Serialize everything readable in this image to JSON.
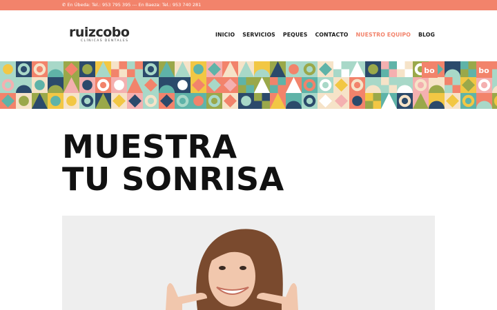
{
  "topbar": {
    "contact": "En Úbeda: Tel.: 953 795 395 --- En Baeza: Tel.: 953 740 281",
    "phone_icon": "phone-icon"
  },
  "logo": {
    "word": "ruizcobo",
    "tagline": "CLÍNICAS DENTALES"
  },
  "nav": {
    "items": [
      {
        "label": "INICIO"
      },
      {
        "label": "SERVICIOS"
      },
      {
        "label": "PEQUES"
      },
      {
        "label": "CONTACTO"
      },
      {
        "label": "NUESTRO EQUIPO"
      },
      {
        "label": "BLOG"
      }
    ]
  },
  "hero": {
    "line1": "MUESTRA",
    "line2": "TU SONRISA"
  },
  "pattern": {
    "badge_text": "bo"
  },
  "colors": {
    "accent": "#f2836b",
    "navy": "#2b4a6b",
    "teal": "#5fb3a8",
    "mint": "#a8d8c8",
    "yellow": "#f2c744",
    "olive": "#9aa84a",
    "pink": "#f4b0b0",
    "cream": "#f6e3c8",
    "text": "#111111"
  }
}
